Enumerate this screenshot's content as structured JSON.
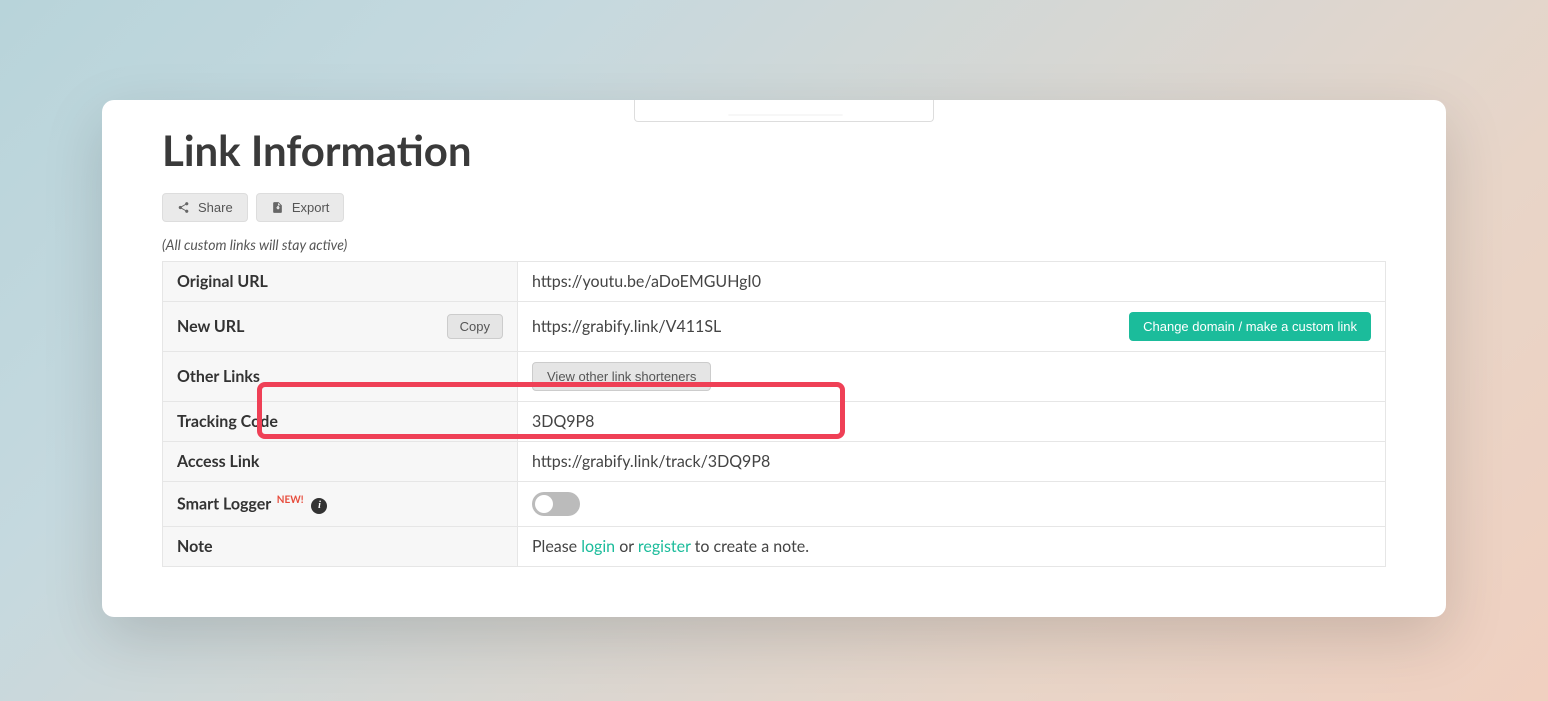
{
  "title": "Link Information",
  "buttons": {
    "share": "Share",
    "export": "Export"
  },
  "note_top": "(All custom links will stay active)",
  "rows": {
    "original_url": {
      "label": "Original URL",
      "value": "https://youtu.be/aDoEMGUHgI0"
    },
    "new_url": {
      "label": "New URL",
      "value": "https://grabify.link/V411SL",
      "copy": "Copy",
      "change": "Change domain / make a custom link"
    },
    "other_links": {
      "label": "Other Links",
      "button": "View other link shorteners"
    },
    "tracking_code": {
      "label": "Tracking Code",
      "value": "3DQ9P8"
    },
    "access_link": {
      "label": "Access Link",
      "value": "https://grabify.link/track/3DQ9P8"
    },
    "smart_logger": {
      "label": "Smart Logger",
      "badge": "NEW!"
    },
    "note": {
      "label": "Note",
      "prefix": "Please ",
      "login": "login",
      "or": " or ",
      "register": "register",
      "suffix": " to create a note."
    }
  }
}
